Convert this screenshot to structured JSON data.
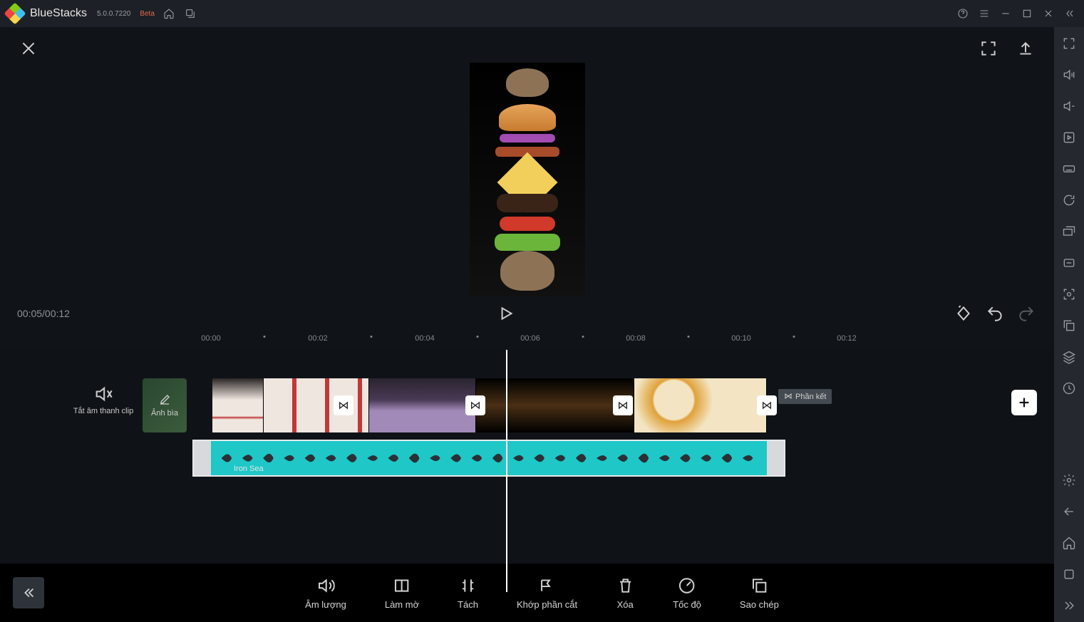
{
  "titlebar": {
    "app_name": "BlueStacks",
    "version": "5.0.0.7220",
    "beta": "Beta"
  },
  "transport": {
    "time": "00:05/00:12"
  },
  "ruler": [
    "00:00",
    "00:02",
    "00:04",
    "00:06",
    "00:08",
    "00:10",
    "00:12"
  ],
  "timeline": {
    "mute_label": "Tắt âm thanh clip",
    "cover_label": "Ảnh bìa",
    "audio_label": "Iron Sea",
    "end_label": "Phần kết"
  },
  "bottom_tools": [
    {
      "id": "volume",
      "label": "Âm lượng"
    },
    {
      "id": "fade",
      "label": "Làm mờ"
    },
    {
      "id": "detach",
      "label": "Tách"
    },
    {
      "id": "fit",
      "label": "Khớp phần cắt"
    },
    {
      "id": "delete",
      "label": "Xóa"
    },
    {
      "id": "speed",
      "label": "Tốc độ"
    },
    {
      "id": "copy",
      "label": "Sao chép"
    }
  ]
}
